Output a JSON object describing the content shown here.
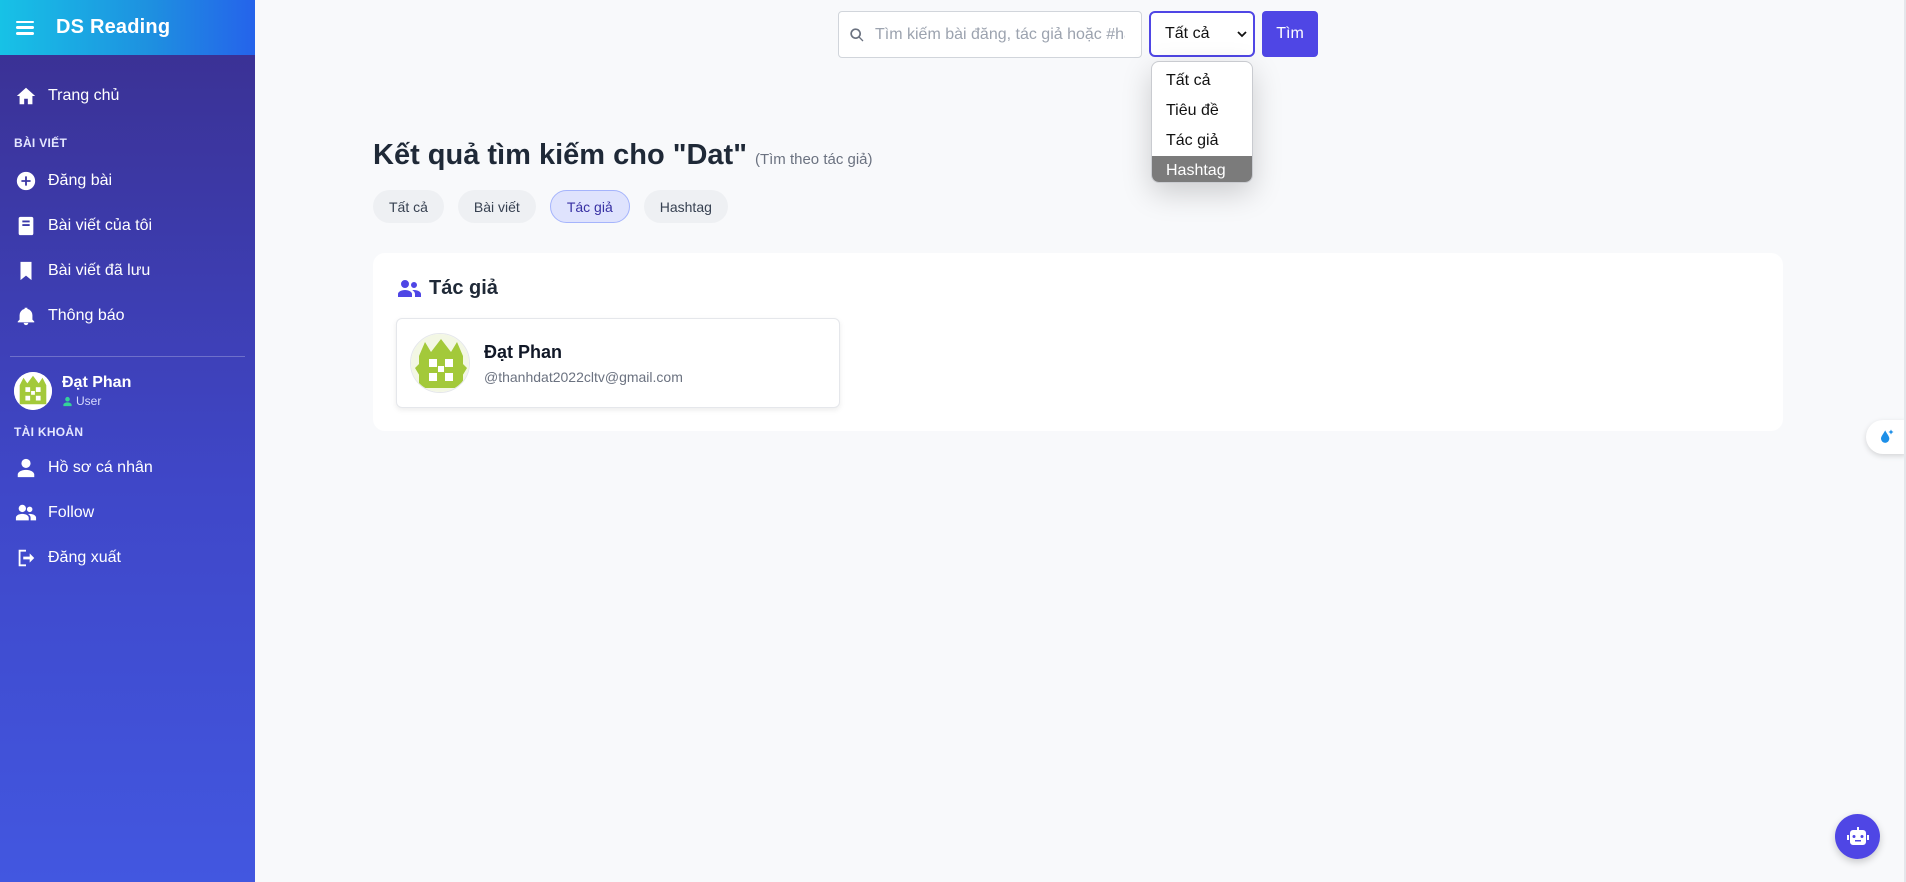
{
  "app": {
    "title": "DS Reading"
  },
  "sidebar": {
    "home": "Trang chủ",
    "section_posts": "BÀI VIẾT",
    "items": [
      {
        "label": "Đăng bài",
        "icon": "plus-circle-icon"
      },
      {
        "label": "Bài viết của tôi",
        "icon": "book-icon"
      },
      {
        "label": "Bài viết đã lưu",
        "icon": "bookmark-icon"
      },
      {
        "label": "Thông báo",
        "icon": "bell-icon"
      }
    ],
    "user": {
      "name": "Đạt Phan",
      "role": "User"
    },
    "section_account": "TÀI KHOẢN",
    "account_items": [
      {
        "label": "Hồ sơ cá nhân",
        "icon": "user-icon"
      },
      {
        "label": "Follow",
        "icon": "users-icon"
      },
      {
        "label": "Đăng xuất",
        "icon": "logout-icon"
      }
    ]
  },
  "search": {
    "placeholder": "Tìm kiếm bài đăng, tác giả hoặc #hashtag",
    "value": "",
    "select_value": "Tất cả",
    "button": "Tìm",
    "options": [
      "Tất cả",
      "Tiêu đề",
      "Tác giả",
      "Hashtag"
    ],
    "highlighted_option": "Hashtag"
  },
  "results": {
    "title": "Kết quả tìm kiếm cho \"Dat\"",
    "subtitle": "(Tìm theo tác giả)",
    "filters": [
      "Tất cả",
      "Bài viết",
      "Tác giả",
      "Hashtag"
    ],
    "active_filter": "Tác giả",
    "section_title": "Tác giả",
    "authors": [
      {
        "name": "Đạt Phan",
        "email": "@thanhdat2022cltv@gmail.com"
      }
    ]
  },
  "colors": {
    "accent": "#4f46e5",
    "sidebar_top": "#3a2f8f",
    "sidebar_bottom": "#4257e0",
    "brand_gradient_start": "#17c2e6",
    "avatar_green": "#a3c93a"
  }
}
